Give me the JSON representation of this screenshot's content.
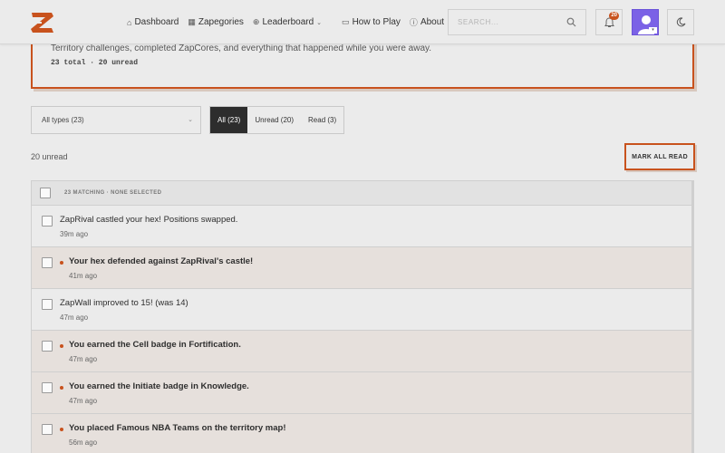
{
  "nav": {
    "items": [
      {
        "label": "Dashboard",
        "icon": "home-icon"
      },
      {
        "label": "Zapegories",
        "icon": "grid-icon"
      },
      {
        "label": "Leaderboard",
        "icon": "plus-circle-icon"
      },
      {
        "label": "How to Play",
        "icon": "video-icon"
      },
      {
        "label": "About",
        "icon": "info-icon"
      }
    ]
  },
  "search": {
    "placeholder": "SEARCH..."
  },
  "notifications_badge": "20",
  "header": {
    "description": "Territory challenges, completed ZapCores, and everything that happened while you were away.",
    "counts": "23 total · 20 unread"
  },
  "filters": {
    "type_select": "All types (23)",
    "tabs": [
      "All (23)",
      "Unread (20)",
      "Read (3)"
    ],
    "active_tab": "All (23)"
  },
  "unread_label": "20 unread",
  "mark_all_label": "MARK ALL READ",
  "list_header": "23 MATCHING · NONE SELECTED",
  "notifications": [
    {
      "title": "ZapRival castled your hex! Positions swapped.",
      "time": "39m ago",
      "unread": false
    },
    {
      "title": "Your hex defended against ZapRival's castle!",
      "time": "41m ago",
      "unread": true
    },
    {
      "title": "ZapWall improved to 15! (was 14)",
      "time": "47m ago",
      "unread": false
    },
    {
      "title": "You earned the Cell badge in Fortification.",
      "time": "47m ago",
      "unread": true
    },
    {
      "title": "You earned the Initiate badge in Knowledge.",
      "time": "47m ago",
      "unread": true
    },
    {
      "title": "You placed Famous NBA Teams on the territory map!",
      "time": "56m ago",
      "unread": true
    }
  ],
  "colors": {
    "accent": "#c8521d",
    "avatar": "#7b62e6",
    "dark": "#2d2d2d"
  }
}
